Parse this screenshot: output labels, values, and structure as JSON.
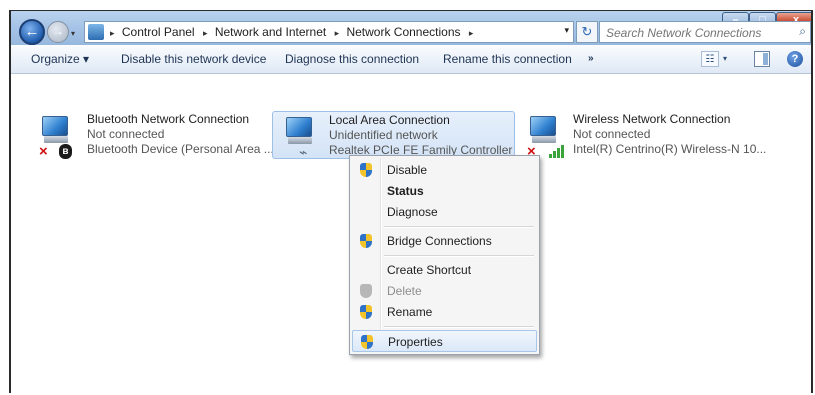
{
  "window": {
    "controls": {
      "minimize": "–",
      "maximize": "□",
      "close": "x"
    }
  },
  "nav": {
    "back_glyph": "←",
    "forward_glyph": "→",
    "history_glyph": "▾"
  },
  "address": {
    "breadcrumbs": [
      "Control Panel",
      "Network and Internet",
      "Network Connections"
    ],
    "separator": "▸",
    "trailing_separator": "▸",
    "dropdown_glyph": "▾"
  },
  "refresh_glyph": "↻",
  "search": {
    "placeholder": "Search Network Connections",
    "icon": "⌕"
  },
  "toolbar": {
    "organize": "Organize ▾",
    "disable": "Disable this network device",
    "diagnose": "Diagnose this connection",
    "rename": "Rename this connection",
    "more": "»",
    "views_glyph": "☷",
    "views_drop": "▾",
    "help": "?"
  },
  "connections": [
    {
      "name": "Bluetooth Network Connection",
      "status": "Not connected",
      "device": "Bluetooth Device (Personal Area ...",
      "icon": "bluetooth-adapter-icon",
      "status_badge": "×",
      "bt_badge": "ʙ"
    },
    {
      "name": "Local Area Connection",
      "status": "Unidentified network",
      "device": "Realtek PCIe FE Family Controller",
      "icon": "ethernet-adapter-icon",
      "cable_badge": "⌁"
    },
    {
      "name": "Wireless Network Connection",
      "status": "Not connected",
      "device": "Intel(R) Centrino(R) Wireless-N 10...",
      "icon": "wireless-adapter-icon",
      "status_badge": "×"
    }
  ],
  "context_menu": {
    "items": [
      {
        "label": "Disable",
        "shield": true,
        "bold": false,
        "disabled": false
      },
      {
        "label": "Status",
        "shield": false,
        "bold": true,
        "disabled": false
      },
      {
        "label": "Diagnose",
        "shield": false,
        "bold": false,
        "disabled": false
      },
      {
        "label": "Bridge Connections",
        "shield": true,
        "bold": false,
        "disabled": false
      },
      {
        "label": "Create Shortcut",
        "shield": false,
        "bold": false,
        "disabled": false
      },
      {
        "label": "Delete",
        "shield": true,
        "bold": false,
        "disabled": true
      },
      {
        "label": "Rename",
        "shield": true,
        "bold": false,
        "disabled": false
      },
      {
        "label": "Properties",
        "shield": true,
        "bold": false,
        "disabled": false,
        "highlighted": true
      }
    ]
  },
  "colors": {
    "selection_fill": "#d3e3f6",
    "selection_border": "#9ec0e7",
    "close_button": "#c8462c",
    "error_badge": "#d01010",
    "signal_green": "#3aa43a"
  }
}
